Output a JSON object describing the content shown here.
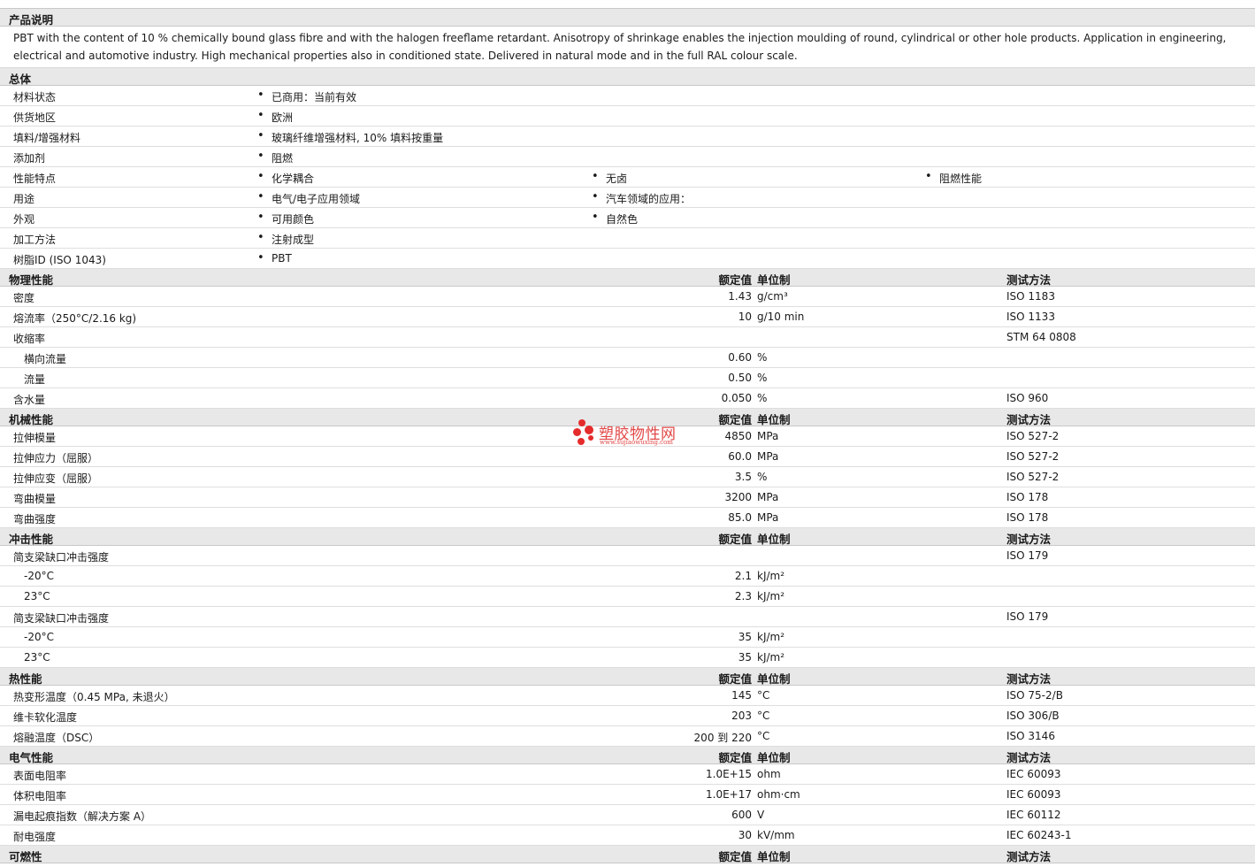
{
  "description": {
    "title": "产品说明",
    "text": "PBT with the content of 10 % chemically bound glass fibre and with the halogen freeflame retardant. Anisotropy of shrinkage enables the injection moulding of round, cylindrical or other hole products. Application in engineering, electrical and automotive industry. High mechanical properties also in conditioned state. Delivered in natural mode and in the full RAL colour scale."
  },
  "general": {
    "title": "总体",
    "rows": [
      {
        "label": "材料状态",
        "values": [
          "已商用：当前有效"
        ]
      },
      {
        "label": "供货地区",
        "values": [
          "欧洲"
        ]
      },
      {
        "label": "填料/增强材料",
        "values": [
          "玻璃纤维增强材料, 10% 填料按重量"
        ]
      },
      {
        "label": "添加剂",
        "values": [
          "阻燃"
        ]
      },
      {
        "label": "性能特点",
        "values": [
          "化学耦合",
          "无卤",
          "阻燃性能"
        ]
      },
      {
        "label": "用途",
        "values": [
          "电气/电子应用领域",
          "汽车领域的应用："
        ]
      },
      {
        "label": "外观",
        "values": [
          "可用颜色",
          "自然色"
        ]
      },
      {
        "label": "加工方法",
        "values": [
          "注射成型"
        ]
      },
      {
        "label": "树脂ID (ISO 1043)",
        "values": [
          "PBT"
        ]
      }
    ]
  },
  "col_headers": {
    "value": "额定值",
    "unit": "单位制",
    "method": "测试方法"
  },
  "sections": [
    {
      "title": "物理性能",
      "rows": [
        {
          "label": "密度",
          "value": "1.43",
          "unit": "g/cm³",
          "method": "ISO 1183"
        },
        {
          "label": "熔流率（250°C/2.16 kg)",
          "value": "10",
          "unit": "g/10 min",
          "method": "ISO 1133"
        },
        {
          "label": "收缩率",
          "value": "",
          "unit": "",
          "method": "STM 64 0808"
        },
        {
          "label": "横向流量",
          "indent": true,
          "value": "0.60",
          "unit": "%",
          "method": ""
        },
        {
          "label": "流量",
          "indent": true,
          "value": "0.50",
          "unit": "%",
          "method": ""
        },
        {
          "label": "含水量",
          "value": "0.050",
          "unit": "%",
          "method": "ISO 960"
        }
      ]
    },
    {
      "title": "机械性能",
      "rows": [
        {
          "label": "拉伸模量",
          "value": "4850",
          "unit": "MPa",
          "method": "ISO 527-2"
        },
        {
          "label": "拉伸应力（屈服）",
          "value": "60.0",
          "unit": "MPa",
          "method": "ISO 527-2"
        },
        {
          "label": "拉伸应变（屈服）",
          "value": "3.5",
          "unit": "%",
          "method": "ISO 527-2"
        },
        {
          "label": "弯曲模量",
          "value": "3200",
          "unit": "MPa",
          "method": "ISO 178"
        },
        {
          "label": "弯曲强度",
          "value": "85.0",
          "unit": "MPa",
          "method": "ISO 178"
        }
      ]
    },
    {
      "title": "冲击性能",
      "rows": [
        {
          "label": "简支梁缺口冲击强度",
          "value": "",
          "unit": "",
          "method": "ISO 179"
        },
        {
          "label": "-20°C",
          "indent": true,
          "value": "2.1",
          "unit": "kJ/m²",
          "method": ""
        },
        {
          "label": "23°C",
          "indent": true,
          "value": "2.3",
          "unit": "kJ/m²",
          "method": ""
        },
        {
          "label": "简支梁缺口冲击强度",
          "value": "",
          "unit": "",
          "method": "ISO 179"
        },
        {
          "label": "-20°C",
          "indent": true,
          "value": "35",
          "unit": "kJ/m²",
          "method": ""
        },
        {
          "label": "23°C",
          "indent": true,
          "value": "35",
          "unit": "kJ/m²",
          "method": ""
        }
      ]
    },
    {
      "title": "热性能",
      "rows": [
        {
          "label": "热变形温度（0.45 MPa, 未退火）",
          "value": "145",
          "unit": "°C",
          "method": "ISO 75-2/B"
        },
        {
          "label": "维卡软化温度",
          "value": "203",
          "unit": "°C",
          "method": "ISO 306/B"
        },
        {
          "label": "熔融温度（DSC）",
          "value": "200 到  220",
          "unit": "°C",
          "method": "ISO 3146"
        }
      ]
    },
    {
      "title": "电气性能",
      "rows": [
        {
          "label": "表面电阻率",
          "value": "1.0E+15",
          "unit": "ohm",
          "method": "IEC 60093"
        },
        {
          "label": "体积电阻率",
          "value": "1.0E+17",
          "unit": "ohm·cm",
          "method": "IEC 60093"
        },
        {
          "label": "漏电起痕指数（解决方案 A）",
          "value": "600",
          "unit": "V",
          "method": "IEC 60112"
        },
        {
          "label": "耐电强度",
          "value": "30",
          "unit": "kV/mm",
          "method": "IEC 60243-1"
        }
      ]
    },
    {
      "title": "可燃性",
      "rows": []
    }
  ],
  "watermark": {
    "name": "塑胶物性网",
    "url": "www.sujiaowuxing.com",
    "color": "#e52b2b"
  }
}
